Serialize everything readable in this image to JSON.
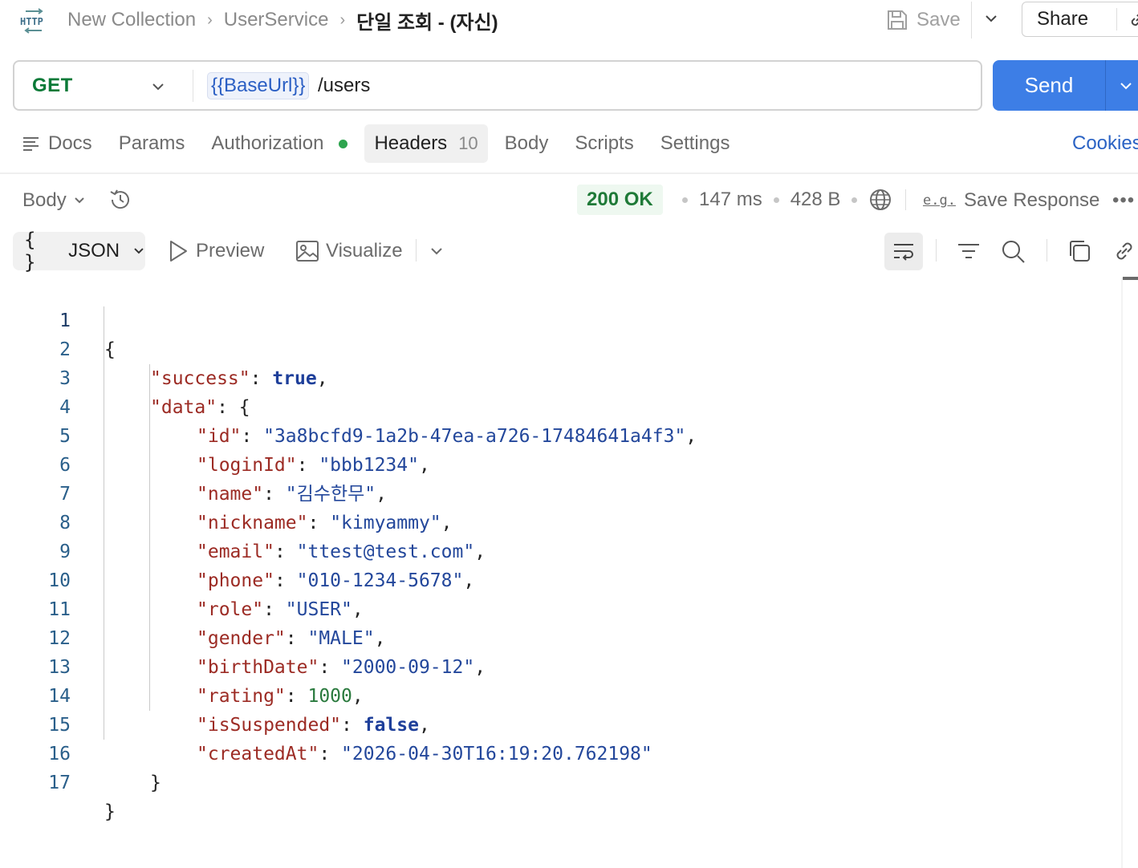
{
  "header": {
    "icon_label": "HTTP",
    "breadcrumb": [
      {
        "label": "New Collection"
      },
      {
        "label": "UserService"
      },
      {
        "label": "단일 조회 - (자신)"
      }
    ],
    "save_label": "Save",
    "share_label": "Share"
  },
  "request": {
    "method": "GET",
    "url_variable": "{{BaseUrl}}",
    "url_path": "/users",
    "send_label": "Send"
  },
  "request_tabs": {
    "docs": "Docs",
    "params": "Params",
    "authorization": "Authorization",
    "headers": "Headers",
    "headers_count": "10",
    "body": "Body",
    "scripts": "Scripts",
    "settings": "Settings",
    "cookies": "Cookies",
    "active": "Headers"
  },
  "response": {
    "body_selector": "Body",
    "status": "200 OK",
    "time": "147 ms",
    "size": "428 B",
    "save_response_icon": "e.g.",
    "save_response_label": "Save Response",
    "format": "JSON",
    "format_braces": "{ }",
    "preview_label": "Preview",
    "visualize_label": "Visualize"
  },
  "code": {
    "line_numbers": [
      "1",
      "2",
      "3",
      "4",
      "5",
      "6",
      "7",
      "8",
      "9",
      "10",
      "11",
      "12",
      "13",
      "14",
      "15",
      "16",
      "17"
    ],
    "open_brace": "{",
    "close_brace": "}",
    "success_key": "\"success\"",
    "success_value": "true",
    "data_key": "\"data\"",
    "fields": [
      {
        "key": "\"id\"",
        "value": "\"3a8bcfd9-1a2b-47ea-a726-17484641a4f3\""
      },
      {
        "key": "\"loginId\"",
        "value": "\"bbb1234\""
      },
      {
        "key": "\"name\"",
        "value": "\"김수한무\""
      },
      {
        "key": "\"nickname\"",
        "value": "\"kimyammy\""
      },
      {
        "key": "\"email\"",
        "value": "\"ttest@test.com\""
      },
      {
        "key": "\"phone\"",
        "value": "\"010-1234-5678\""
      },
      {
        "key": "\"role\"",
        "value": "\"USER\""
      },
      {
        "key": "\"gender\"",
        "value": "\"MALE\""
      },
      {
        "key": "\"birthDate\"",
        "value": "\"2000-09-12\""
      },
      {
        "key": "\"rating\"",
        "value": "1000"
      },
      {
        "key": "\"isSuspended\"",
        "value": "false"
      },
      {
        "key": "\"createdAt\"",
        "value": "\"2026-04-30T16:19:20.762198\""
      }
    ]
  },
  "colors": {
    "send_button": "#3d7ee6",
    "method_get": "#0b7a38",
    "status_ok": "#1f7a38",
    "json_key": "#9c2b24",
    "json_string": "#23479b",
    "json_number": "#2a7a3e"
  }
}
